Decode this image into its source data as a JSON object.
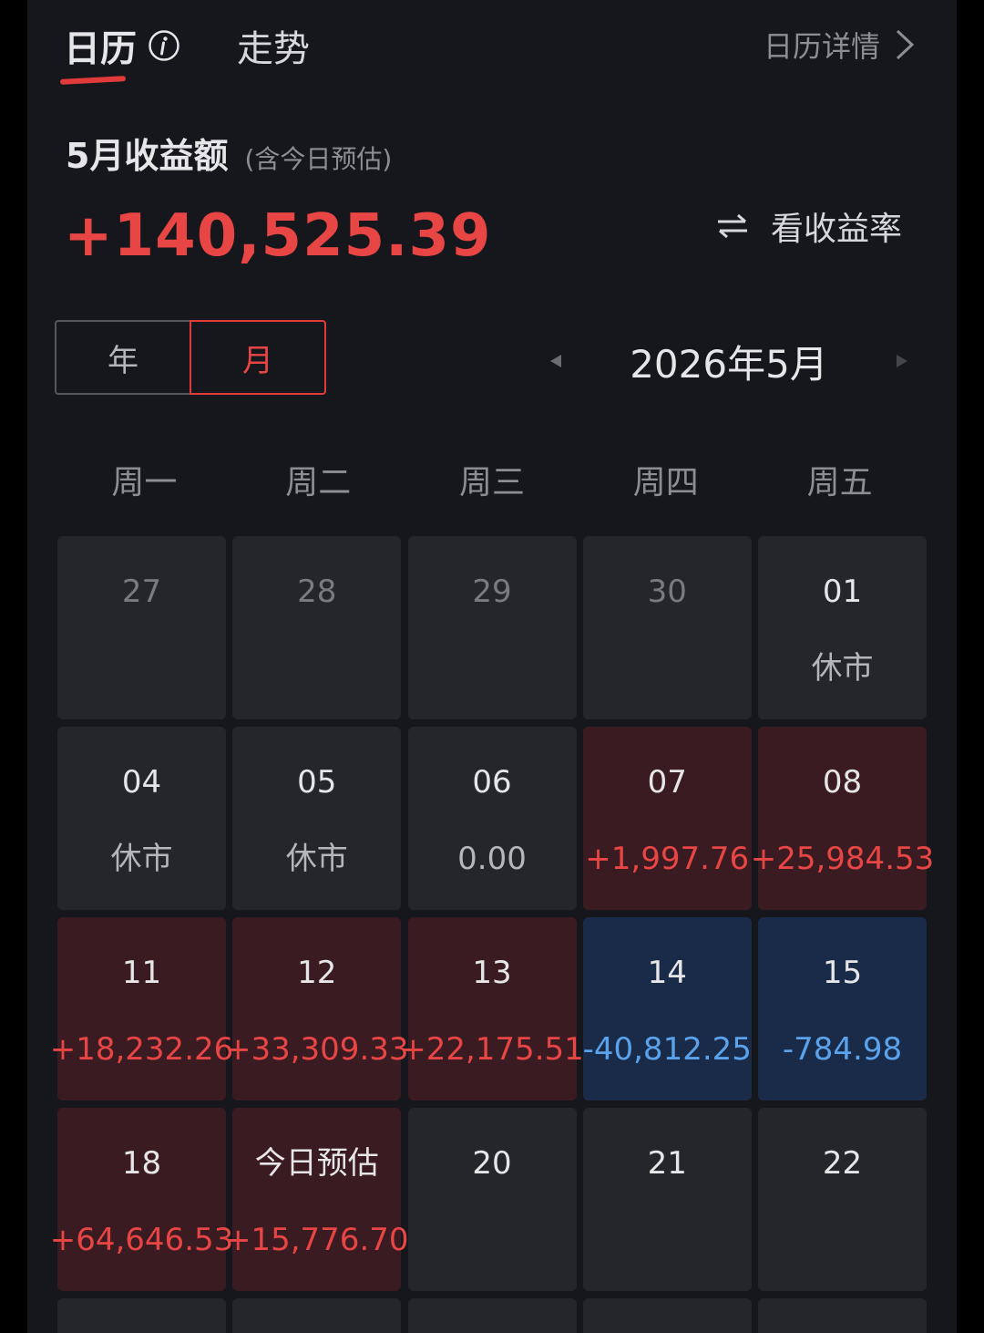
{
  "header": {
    "tab_calendar": "日历",
    "tab_trend": "走势",
    "detail_link": "日历详情"
  },
  "summary": {
    "title": "5月收益额",
    "subtitle": "(含今日预估)",
    "amount": "+140,525.39",
    "toggle_label": "看收益率"
  },
  "period_toggle": {
    "year_label": "年",
    "month_label": "月",
    "selected": "month"
  },
  "month_nav": {
    "label": "2026年5月"
  },
  "weekdays": [
    "周一",
    "周二",
    "周三",
    "周四",
    "周五"
  ],
  "days": [
    {
      "day": "27",
      "value": "",
      "state": "prev"
    },
    {
      "day": "28",
      "value": "",
      "state": "prev"
    },
    {
      "day": "29",
      "value": "",
      "state": "prev"
    },
    {
      "day": "30",
      "value": "",
      "state": "prev"
    },
    {
      "day": "01",
      "value": "休市",
      "state": "closed"
    },
    {
      "day": "04",
      "value": "休市",
      "state": "closed"
    },
    {
      "day": "05",
      "value": "休市",
      "state": "closed"
    },
    {
      "day": "06",
      "value": "0.00",
      "state": "flat"
    },
    {
      "day": "07",
      "value": "+1,997.76",
      "state": "gain"
    },
    {
      "day": "08",
      "value": "+25,984.53",
      "state": "gain"
    },
    {
      "day": "11",
      "value": "+18,232.26",
      "state": "gain"
    },
    {
      "day": "12",
      "value": "+33,309.33",
      "state": "gain"
    },
    {
      "day": "13",
      "value": "+22,175.51",
      "state": "gain"
    },
    {
      "day": "14",
      "value": "-40,812.25",
      "state": "loss"
    },
    {
      "day": "15",
      "value": "-784.98",
      "state": "loss"
    },
    {
      "day": "18",
      "value": "+64,646.53",
      "state": "gain"
    },
    {
      "day": "今日预估",
      "value": "+15,776.70",
      "state": "gain"
    },
    {
      "day": "20",
      "value": "",
      "state": "future"
    },
    {
      "day": "21",
      "value": "",
      "state": "future"
    },
    {
      "day": "22",
      "value": "",
      "state": "future"
    }
  ],
  "colors": {
    "accent_red": "#e84545",
    "loss_blue": "#5aa3ec",
    "gain_bg": "#3a1b22",
    "loss_bg": "#1a2b49",
    "cell_bg": "#24262c",
    "page_bg": "#16171c"
  },
  "icons": {
    "info": "info-icon",
    "chevron": "chevron-right-icon",
    "swap": "swap-arrows-icon",
    "prev": "caret-left-icon",
    "next": "caret-right-icon"
  }
}
